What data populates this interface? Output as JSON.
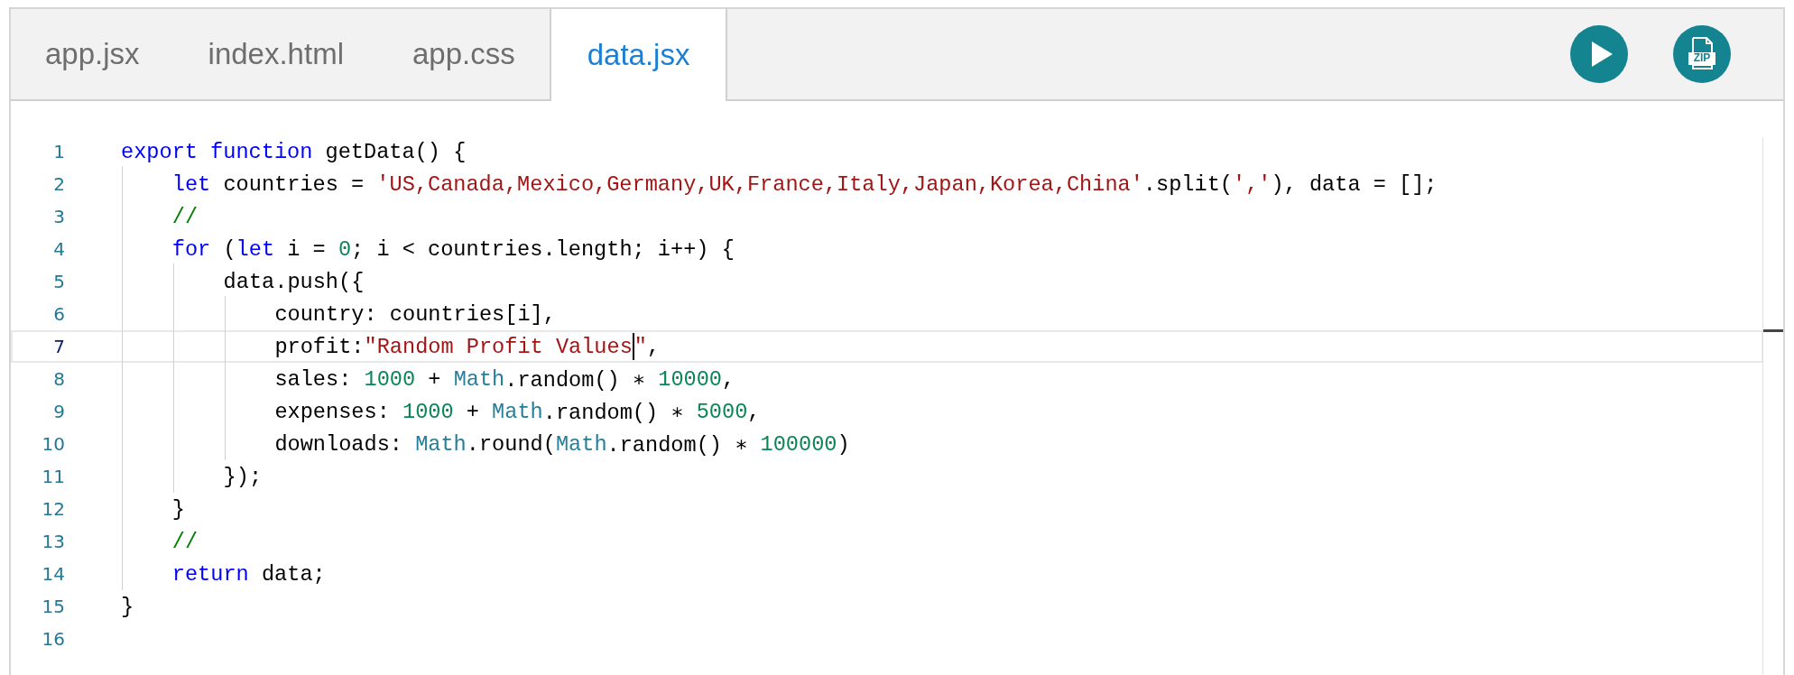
{
  "tabs": [
    {
      "label": "app.jsx",
      "selected": false
    },
    {
      "label": "index.html",
      "selected": false
    },
    {
      "label": "app.css",
      "selected": false
    },
    {
      "label": "data.jsx",
      "selected": true
    }
  ],
  "toolbar": {
    "buttons": [
      {
        "kind": "run"
      },
      {
        "kind": "zip",
        "label": "ZIP"
      }
    ]
  },
  "editor": {
    "lines": [
      {
        "number": "1",
        "current": false,
        "tokens": [
          {
            "kind": "keyword",
            "text": "export function"
          },
          {
            "kind": "plain",
            "text": " getData() {"
          }
        ],
        "children": [
          {
            "number": "2",
            "current": false,
            "tokens": [
              {
                "kind": "keyword",
                "text": "let"
              },
              {
                "kind": "plain",
                "text": " countries = "
              },
              {
                "kind": "string",
                "text": "'US,Canada,Mexico,Germany,UK,France,Italy,Japan,Korea,China'"
              },
              {
                "kind": "plain",
                "text": ".split("
              },
              {
                "kind": "string",
                "text": "','"
              },
              {
                "kind": "plain",
                "text": "), data = [];"
              }
            ]
          },
          {
            "number": "3",
            "current": false,
            "tokens": [
              {
                "kind": "comment",
                "text": "//"
              }
            ]
          },
          {
            "number": "4",
            "current": false,
            "tokens": [
              {
                "kind": "keyword",
                "text": "for"
              },
              {
                "kind": "plain",
                "text": " ("
              },
              {
                "kind": "keyword",
                "text": "let"
              },
              {
                "kind": "plain",
                "text": " i = "
              },
              {
                "kind": "number",
                "text": "0"
              },
              {
                "kind": "plain",
                "text": "; i < countries.length; i++) {"
              }
            ],
            "children": [
              {
                "number": "5",
                "current": false,
                "tokens": [
                  {
                    "kind": "plain",
                    "text": "data.push({"
                  }
                ],
                "children": [
                  {
                    "number": "6",
                    "current": false,
                    "tokens": [
                      {
                        "kind": "plain",
                        "text": "country: countries[i],"
                      }
                    ]
                  },
                  {
                    "number": "7",
                    "current": true,
                    "tokens": [
                      {
                        "kind": "plain",
                        "text": "profit:"
                      },
                      {
                        "kind": "string",
                        "text": "\"Random Profit Values"
                      },
                      {
                        "kind": "caret"
                      },
                      {
                        "kind": "string",
                        "text": "\""
                      },
                      {
                        "kind": "plain",
                        "text": ","
                      }
                    ]
                  },
                  {
                    "number": "8",
                    "current": false,
                    "tokens": [
                      {
                        "kind": "plain",
                        "text": "sales: "
                      },
                      {
                        "kind": "number",
                        "text": "1000"
                      },
                      {
                        "kind": "plain",
                        "text": " + "
                      },
                      {
                        "kind": "builtin",
                        "text": "Math"
                      },
                      {
                        "kind": "plain",
                        "text": ".random() ∗ "
                      },
                      {
                        "kind": "number",
                        "text": "10000"
                      },
                      {
                        "kind": "plain",
                        "text": ","
                      }
                    ]
                  },
                  {
                    "number": "9",
                    "current": false,
                    "tokens": [
                      {
                        "kind": "plain",
                        "text": "expenses: "
                      },
                      {
                        "kind": "number",
                        "text": "1000"
                      },
                      {
                        "kind": "plain",
                        "text": " + "
                      },
                      {
                        "kind": "builtin",
                        "text": "Math"
                      },
                      {
                        "kind": "plain",
                        "text": ".random() ∗ "
                      },
                      {
                        "kind": "number",
                        "text": "5000"
                      },
                      {
                        "kind": "plain",
                        "text": ","
                      }
                    ]
                  },
                  {
                    "number": "10",
                    "current": false,
                    "tokens": [
                      {
                        "kind": "plain",
                        "text": "downloads: "
                      },
                      {
                        "kind": "builtin",
                        "text": "Math"
                      },
                      {
                        "kind": "plain",
                        "text": ".round("
                      },
                      {
                        "kind": "builtin",
                        "text": "Math"
                      },
                      {
                        "kind": "plain",
                        "text": ".random() ∗ "
                      },
                      {
                        "kind": "number",
                        "text": "100000"
                      },
                      {
                        "kind": "plain",
                        "text": ")"
                      }
                    ]
                  }
                ]
              },
              {
                "number": "11",
                "current": false,
                "tokens": [
                  {
                    "kind": "plain",
                    "text": "});"
                  }
                ]
              }
            ]
          },
          {
            "number": "12",
            "current": false,
            "tokens": [
              {
                "kind": "plain",
                "text": "}"
              }
            ]
          },
          {
            "number": "13",
            "current": false,
            "tokens": [
              {
                "kind": "comment",
                "text": "//"
              }
            ]
          },
          {
            "number": "14",
            "current": false,
            "tokens": [
              {
                "kind": "keyword",
                "text": "return"
              },
              {
                "kind": "plain",
                "text": " data;"
              }
            ]
          }
        ]
      },
      {
        "number": "15",
        "current": false,
        "tokens": [
          {
            "kind": "plain",
            "text": "}"
          }
        ]
      },
      {
        "number": "16",
        "current": false
      }
    ]
  }
}
